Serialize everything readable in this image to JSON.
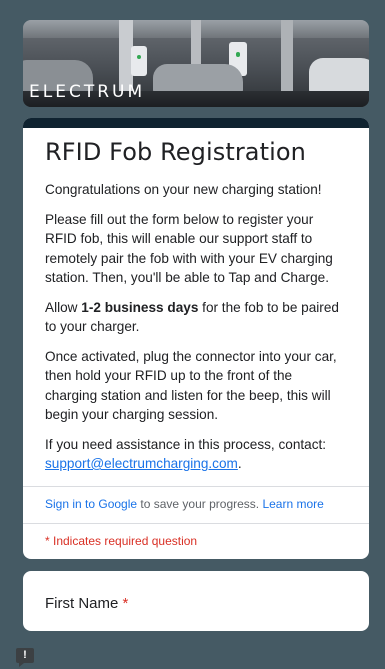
{
  "banner": {
    "logo_text": "ELECTRUM"
  },
  "form": {
    "title": "RFID Fob Registration",
    "desc_1": "Congratulations on your new charging station!",
    "desc_2": "Please fill out the form below to register your RFID fob, this will enable our support staff to remotely pair the fob with with your EV charging station. Then, you'll be able to Tap and Charge.",
    "desc_3_pre": "Allow ",
    "desc_3_bold": "1-2 business days",
    "desc_3_post": " for the fob to be paired to your charger.",
    "desc_4": "Once activated, plug the connector into your car, then hold your RFID up to the front of the charging station and listen for the beep, this will begin your charging session.",
    "desc_5_pre": "If you need assistance in this process, contact: ",
    "desc_5_email": "support@electrumcharging.com",
    "desc_5_post": "."
  },
  "signin": {
    "link": "Sign in to Google",
    "text": " to save your progress. ",
    "learn_more": "Learn more"
  },
  "required_note": "* Indicates required question",
  "question": {
    "label": "First Name",
    "required_mark": "*"
  },
  "feedback": {
    "icon_text": "!"
  },
  "colors": {
    "accent_bar": "#0f2330",
    "link": "#1a73e8",
    "required": "#d93025",
    "background": "#455a64"
  }
}
